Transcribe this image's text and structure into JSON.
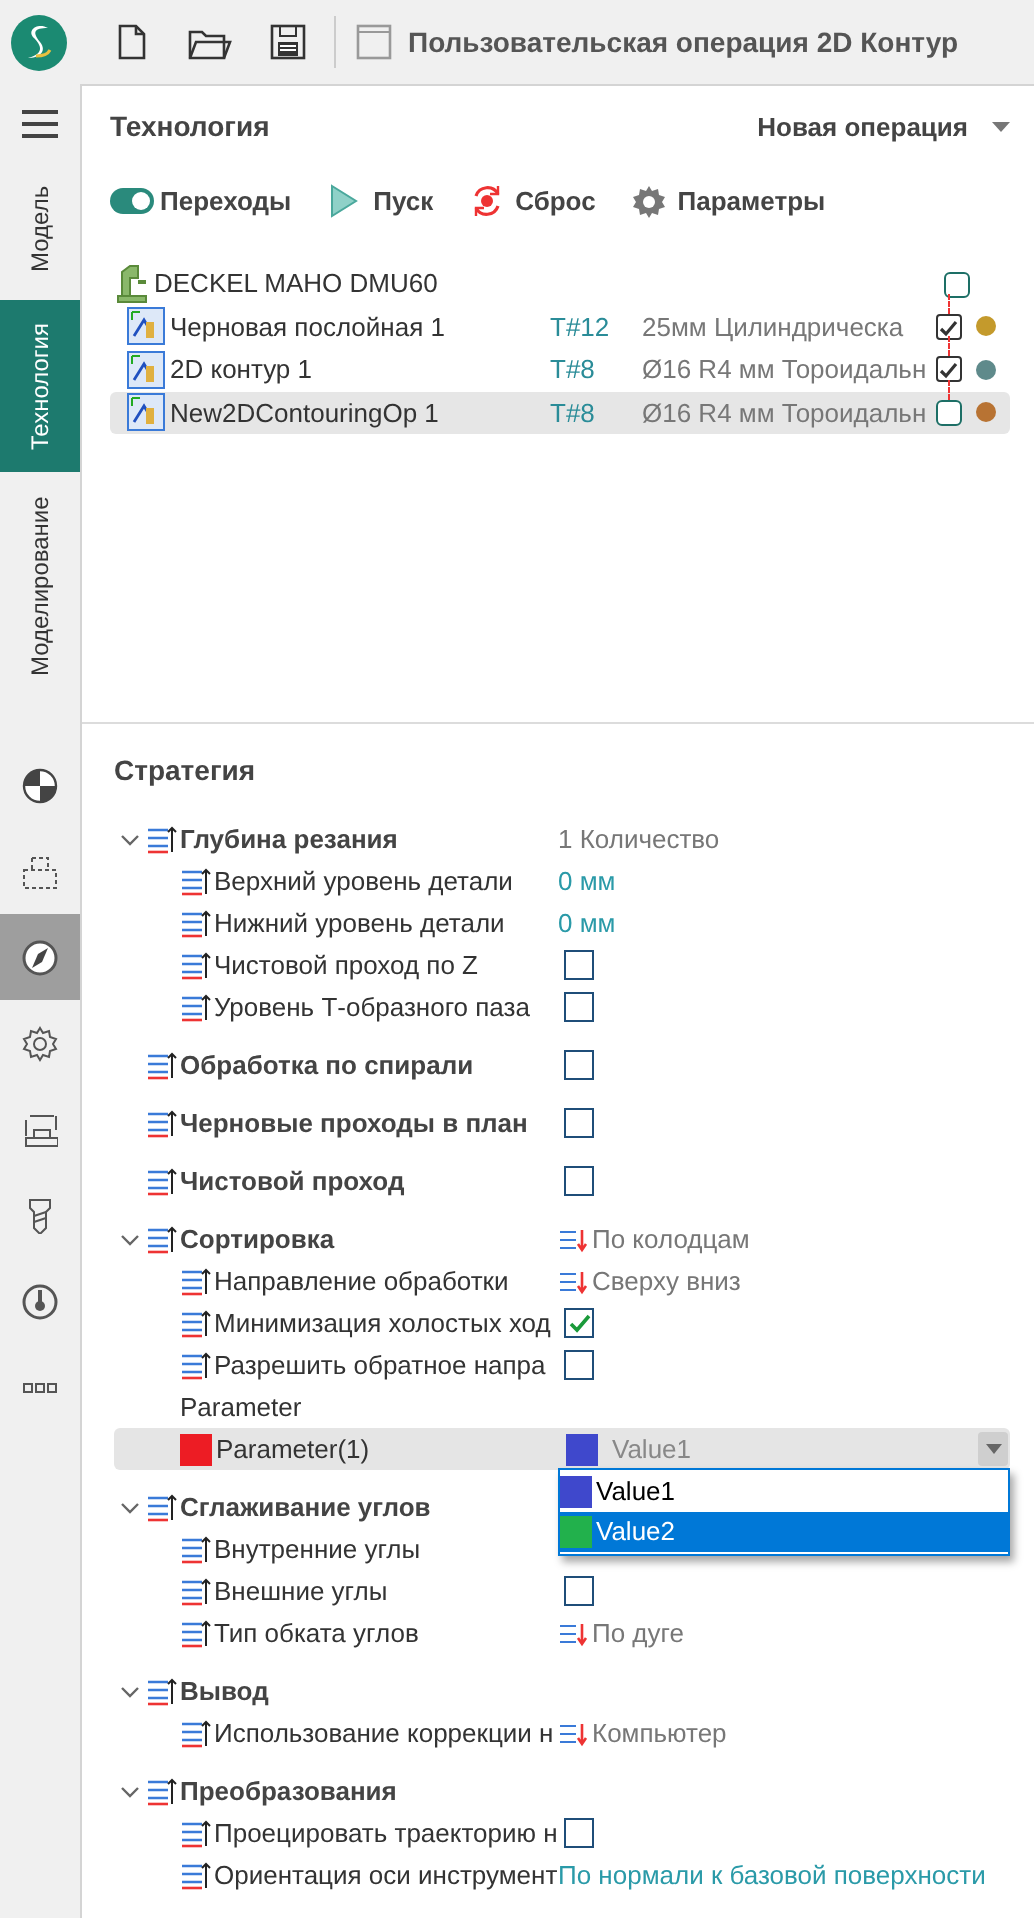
{
  "app_bar": {
    "title": "Пользовательская операция 2D Контур"
  },
  "rail_tabs": [
    {
      "label": "Модель",
      "selected": false
    },
    {
      "label": "Технология",
      "selected": true
    },
    {
      "label": "Моделирование",
      "selected": false
    }
  ],
  "rail_tools": [
    {
      "selected": false
    },
    {
      "selected": false
    },
    {
      "selected": true
    },
    {
      "selected": false
    },
    {
      "selected": false
    },
    {
      "selected": false
    },
    {
      "selected": false
    },
    {
      "selected": false
    }
  ],
  "panel": {
    "title": "Технология",
    "operation_menu": "Новая операция"
  },
  "toolbar": {
    "transitions": {
      "label": "Переходы",
      "on": true
    },
    "buttons": [
      {
        "kind": "run",
        "label": "Пуск"
      },
      {
        "kind": "reset",
        "label": "Сброс"
      },
      {
        "kind": "settings",
        "label": "Параметры"
      }
    ]
  },
  "machine": {
    "name": "DECKEL MAHO DMU60",
    "checked": false
  },
  "operations": [
    {
      "name": "Черновая послойная 1",
      "tool_number": "T#12",
      "tool": "25мм Цилиндрическа",
      "checked": true,
      "color": "#c49a2c",
      "selected": false
    },
    {
      "name": "2D контур 1",
      "tool_number": "T#8",
      "tool": "Ø16 R4 мм Тороидальн",
      "checked": true,
      "color": "#5f8a8b",
      "selected": false
    },
    {
      "name": "New2DContouringOp 1",
      "tool_number": "T#8",
      "tool": "Ø16 R4 мм Тороидальн",
      "checked": false,
      "color": "#b87333",
      "selected": true
    }
  ],
  "strategy": {
    "title": "Стратегия",
    "groups": [
      {
        "label": "Глубина резания",
        "expanded": true,
        "kind": "value",
        "value": "1 Количество",
        "children": [
          {
            "label": "Верхний уровень детали",
            "kind": "link",
            "value": "0 мм"
          },
          {
            "label": "Нижний уровень детали",
            "kind": "link",
            "value": "0 мм"
          },
          {
            "label": "Чистовой проход по Z",
            "kind": "checkbox",
            "checked": false
          },
          {
            "label": "Уровень Т-образного паза",
            "kind": "checkbox",
            "checked": false
          }
        ]
      },
      {
        "label": "Обработка по спирали",
        "kind": "checkbox",
        "checked": false
      },
      {
        "label": "Черновые проходы в план",
        "kind": "checkbox",
        "checked": false
      },
      {
        "label": "Чистовой проход",
        "kind": "checkbox",
        "checked": false
      },
      {
        "label": "Сортировка",
        "expanded": true,
        "kind": "icon_value",
        "value": "По колодцам",
        "children": [
          {
            "label": "Направление обработки",
            "kind": "icon_value",
            "value": "Сверху вниз"
          },
          {
            "label": "Минимизация холостых ход",
            "kind": "checkbox",
            "checked": true
          },
          {
            "label": "Разрешить обратное напра",
            "kind": "checkbox",
            "checked": false
          },
          {
            "label": "Parameter",
            "kind": "label"
          },
          {
            "label": "Parameter(1)",
            "kind": "select",
            "color": "#ed1c24",
            "selected": true,
            "current": {
              "label": "Value1",
              "color": "#3f48cc"
            },
            "open": true,
            "options": [
              {
                "label": "Value1",
                "color": "#3f48cc",
                "selected": false
              },
              {
                "label": "Value2",
                "color": "#22b14c",
                "selected": true
              }
            ]
          }
        ]
      },
      {
        "label": "Сглаживание углов",
        "expanded": true,
        "kind": "none",
        "children": [
          {
            "label": "Внутренние углы",
            "kind": "none"
          },
          {
            "label": "Внешние углы",
            "kind": "checkbox",
            "checked": false
          },
          {
            "label": "Тип обката углов",
            "kind": "icon_value",
            "value": "По дуге"
          }
        ]
      },
      {
        "label": "Вывод",
        "expanded": true,
        "kind": "none",
        "children": [
          {
            "label": "Использование коррекции н",
            "kind": "icon_value",
            "value": "Компьютер"
          }
        ]
      },
      {
        "label": "Преобразования",
        "expanded": true,
        "kind": "none",
        "children": [
          {
            "label": "Проецировать траекторию н",
            "kind": "checkbox",
            "checked": false
          },
          {
            "label": "Ориентация оси инструмент",
            "kind": "link",
            "value": "По нормали к базовой поверхности"
          }
        ]
      }
    ]
  }
}
